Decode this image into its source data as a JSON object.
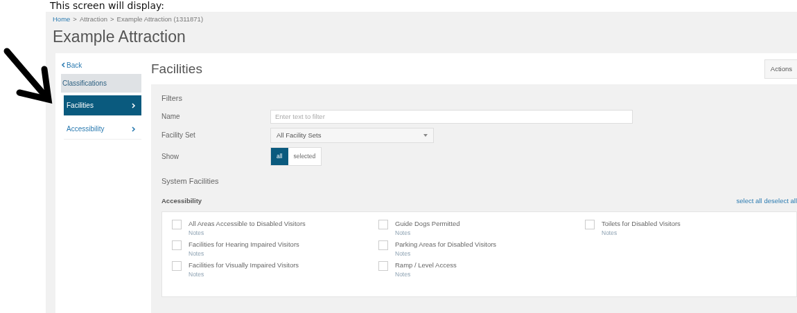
{
  "caption": "This screen will display:",
  "breadcrumb": [
    {
      "label": "Home",
      "kind": "link"
    },
    {
      "label": ">",
      "kind": "separator"
    },
    {
      "label": "Attraction",
      "kind": "text"
    },
    {
      "label": ">",
      "kind": "separator"
    },
    {
      "label": "Example Attraction (1311871)",
      "kind": "text"
    }
  ],
  "page_title": "Example Attraction",
  "sidebar": {
    "back": "Back",
    "group": "Classifications",
    "items": [
      {
        "label": "Facilities",
        "selected": true
      },
      {
        "label": "Accessibility",
        "selected": false
      }
    ]
  },
  "main": {
    "heading": "Facilities",
    "actions_button": "Actions"
  },
  "filters": {
    "title": "Filters",
    "name": {
      "label": "Name",
      "placeholder": "Enter text to filter"
    },
    "facility_set": {
      "label": "Facility Set",
      "value": "All Facility Sets"
    },
    "show": {
      "label": "Show",
      "options": [
        {
          "label": "all",
          "selected": true
        },
        {
          "label": "selected",
          "selected": false
        }
      ]
    }
  },
  "section": {
    "title": "System Facilities",
    "group": "Accessibility",
    "links": [
      "select all",
      "deselect all"
    ],
    "columns": [
      [
        {
          "label": "All Areas Accessible to Disabled Visitors",
          "checked": false,
          "notes": "Notes"
        },
        {
          "label": "Facilities for Hearing Impaired Visitors",
          "checked": false,
          "notes": "Notes"
        },
        {
          "label": "Facilities for Visually Impaired Visitors",
          "checked": false,
          "notes": "Notes"
        }
      ],
      [
        {
          "label": "Guide Dogs Permitted",
          "checked": false,
          "notes": "Notes"
        },
        {
          "label": "Parking Areas for Disabled Visitors",
          "checked": false,
          "notes": "Notes"
        },
        {
          "label": "Ramp / Level Access",
          "checked": false,
          "notes": "Notes"
        }
      ],
      [
        {
          "label": "Toilets for Disabled Visitors",
          "checked": false,
          "notes": "Notes"
        }
      ]
    ]
  }
}
